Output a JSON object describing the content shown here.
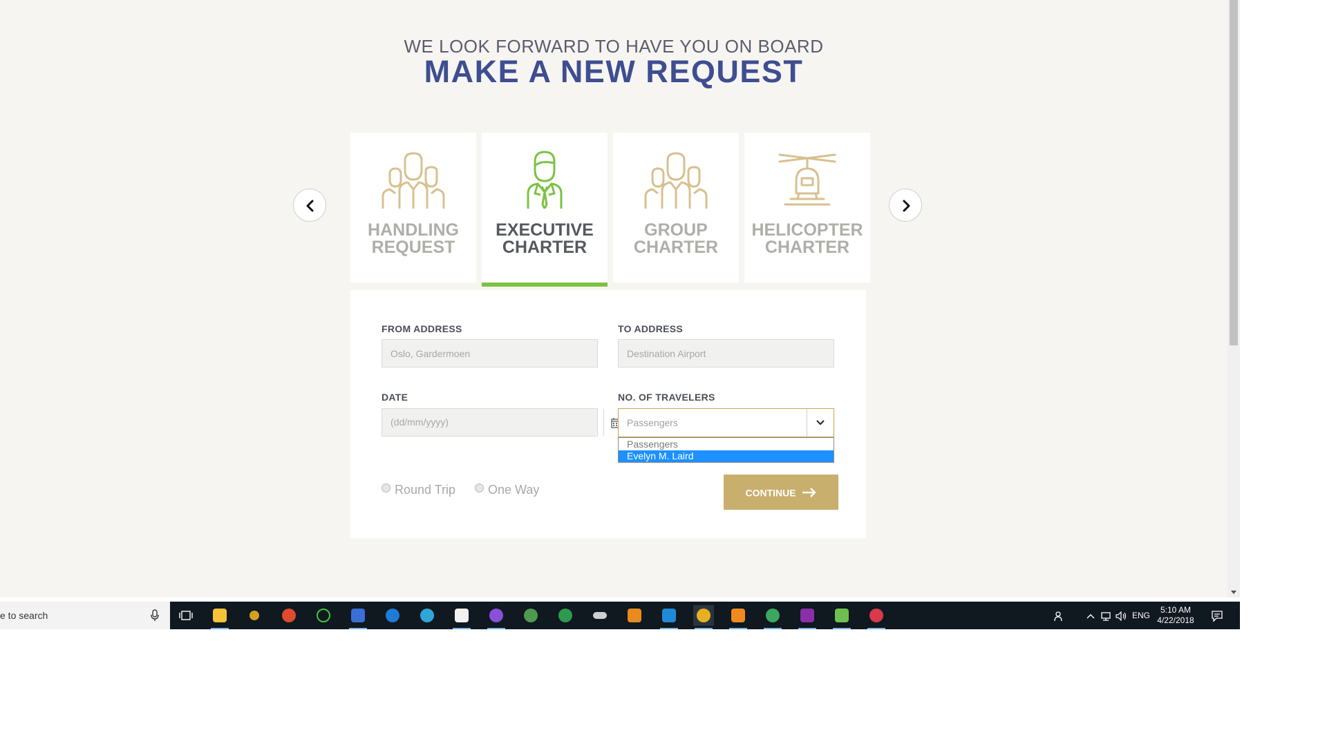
{
  "header": {
    "subtitle": "WE LOOK FORWARD TO HAVE YOU ON BOARD",
    "title": "MAKE A NEW REQUEST"
  },
  "service_cards": [
    {
      "line1": "HANDLING",
      "line2": "REQUEST",
      "icon": "group-people-icon",
      "active": false
    },
    {
      "line1": "EXECUTIVE",
      "line2": "CHARTER",
      "icon": "executive-person-icon",
      "active": true
    },
    {
      "line1": "GROUP",
      "line2": "CHARTER",
      "icon": "group-people-icon",
      "active": false
    },
    {
      "line1": "HELICOPTER",
      "line2": "CHARTER",
      "icon": "helicopter-icon",
      "active": false
    }
  ],
  "colors": {
    "accent_green": "#7cc242",
    "title_blue": "#3f4e91",
    "gold": "#c9af6e",
    "icon_gold": "#d7c08f",
    "page_bg": "#f6f5f1"
  },
  "form": {
    "from_label": "FROM ADDRESS",
    "from_placeholder": "Oslo, Gardermoen",
    "to_label": "TO ADDRESS",
    "to_placeholder": "Destination Airport",
    "date_label": "DATE",
    "date_placeholder": "(dd/mm/yyyy)",
    "travelers_label": "NO. OF TRAVELERS",
    "travelers_value": "Passengers",
    "travelers_options": [
      "Passengers",
      "Evelyn M. Laird"
    ],
    "travelers_highlighted": "Evelyn M. Laird",
    "trip_round": "Round Trip",
    "trip_oneway": "One Way",
    "continue_label": "CONTINUE"
  },
  "taskbar": {
    "search_text": "e to search",
    "language": "ENG",
    "time": "5:10 AM",
    "date": "4/22/2018"
  }
}
